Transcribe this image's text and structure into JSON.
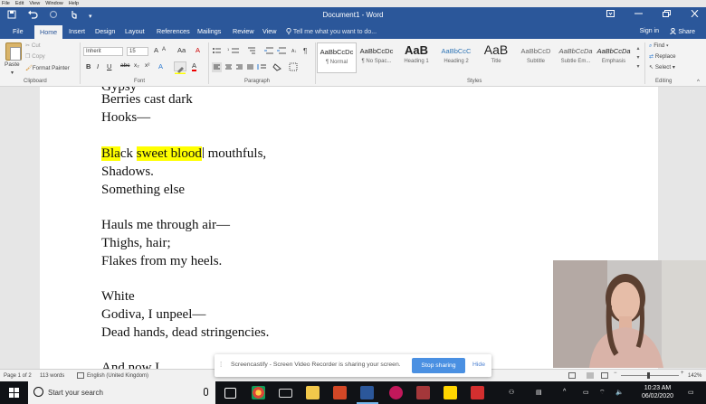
{
  "system_menu": [
    "File",
    "Edit",
    "View",
    "Window",
    "Help"
  ],
  "window": {
    "title": "Document1 - Word",
    "undo_icon": "undo-icon",
    "redo_icon": "redo-icon",
    "save_icon": "save-icon"
  },
  "tabs": [
    "File",
    "Home",
    "Insert",
    "Design",
    "Layout",
    "References",
    "Mailings",
    "Review",
    "View"
  ],
  "active_tab": "Home",
  "tell_me": "Tell me what you want to do...",
  "sign_in": "Sign in",
  "share": "Share",
  "clipboard": {
    "paste": "Paste",
    "cut": "Cut",
    "copy": "Copy",
    "format_painter": "Format Painter",
    "label": "Clipboard"
  },
  "font": {
    "name": "Inherit",
    "size": "15",
    "label": "Font",
    "bold": "B",
    "italic": "I",
    "underline": "U",
    "strike": "abc",
    "subscript": "x₂",
    "superscript": "x²",
    "grow": "A",
    "shrink": "A",
    "case": "Aa",
    "clear": "A"
  },
  "paragraph": {
    "label": "Paragraph"
  },
  "styles": {
    "label": "Styles",
    "items": [
      {
        "preview": "AaBbCcDc",
        "name": "¶ Normal"
      },
      {
        "preview": "AaBbCcDc",
        "name": "¶ No Spac..."
      },
      {
        "preview": "AaB",
        "name": "Heading 1"
      },
      {
        "preview": "AaBbCcC",
        "name": "Heading 2"
      },
      {
        "preview": "AaB",
        "name": "Title"
      },
      {
        "preview": "AaBbCcD",
        "name": "Subtitle"
      },
      {
        "preview": "AaBbCcDa",
        "name": "Subtle Em..."
      },
      {
        "preview": "AaBbCcDa",
        "name": "Emphasis"
      }
    ]
  },
  "editing": {
    "find": "Find",
    "replace": "Replace",
    "select": "Select",
    "label": "Editing"
  },
  "document": {
    "lines": [
      "Berries cast dark",
      "Hooks—",
      "",
      "Black sweet blood mouthfuls,",
      "Shadows.",
      "Something else",
      "",
      "Hauls me through air—",
      "Thighs, hair;",
      "Flakes from my heels.",
      "",
      "White",
      "Godiva, I unpeel—",
      "Dead hands, dead stringencies.",
      "",
      "And now I"
    ],
    "hl_line": {
      "a": "Bla",
      "b": "ck ",
      "c": "sweet blood",
      "d": " mouthfuls,"
    }
  },
  "status": {
    "page": "Page 1 of 2",
    "words": "113 words",
    "language": "English (United Kingdom)",
    "zoom": "142%"
  },
  "screencastify": {
    "message": "Screencastify - Screen Video Recorder is sharing your screen.",
    "stop": "Stop sharing",
    "hide": "Hide"
  },
  "taskbar": {
    "search_placeholder": "Start your search",
    "time": "10:23 AM",
    "date": "06/02/2020"
  }
}
